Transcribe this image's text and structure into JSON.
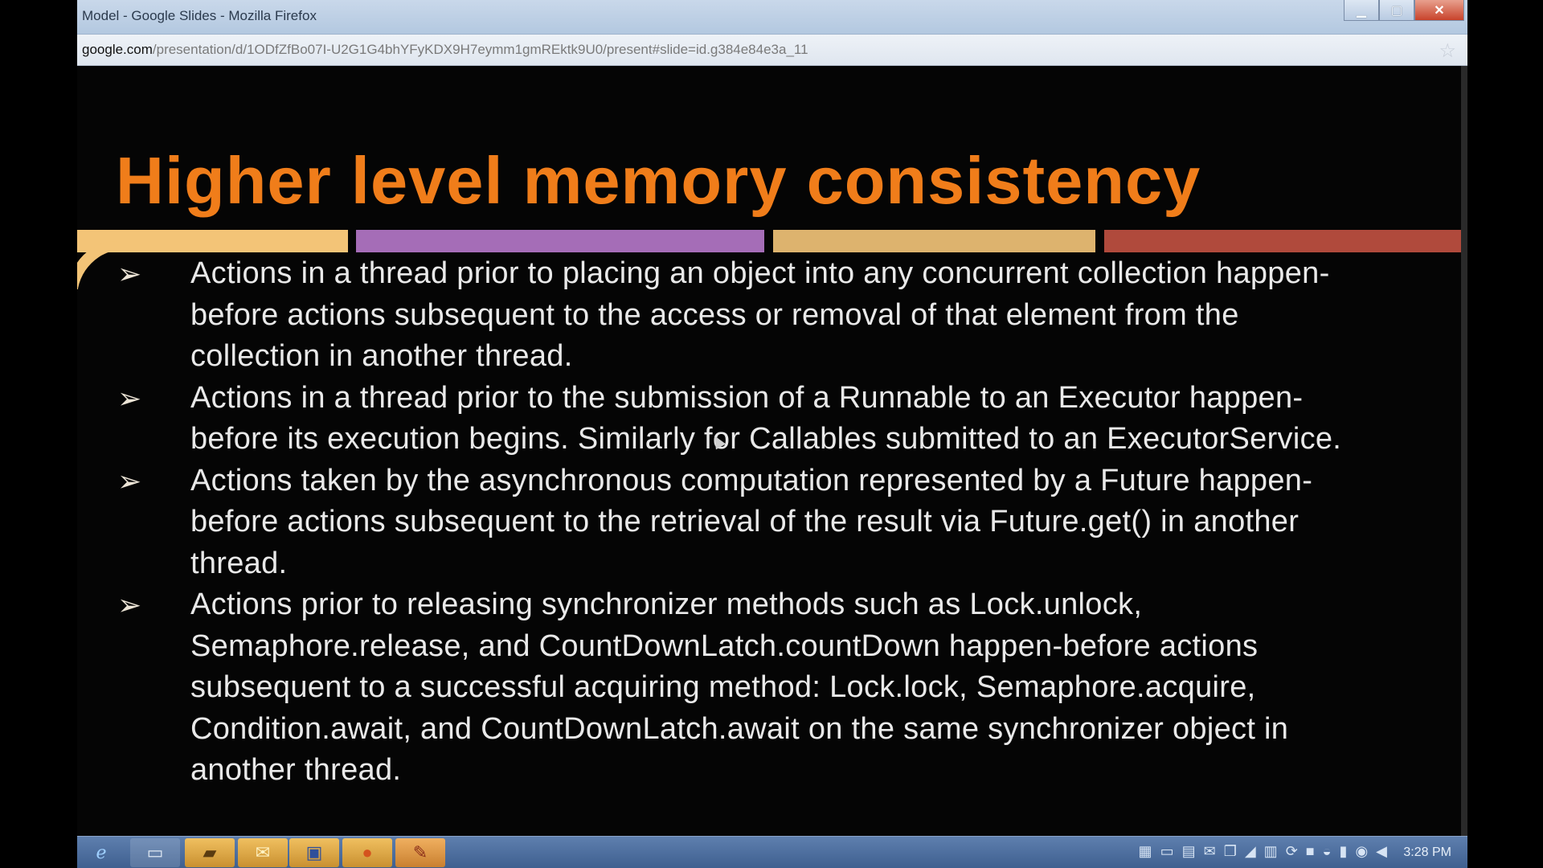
{
  "window": {
    "title": "Model - Google Slides - Mozilla Firefox",
    "minimize_icon": "minimize-icon",
    "maximize_icon": "maximize-icon",
    "close_icon": "close-icon"
  },
  "urlbar": {
    "host": "google.com",
    "path": "/presentation/d/1ODfZfBo07I-U2G1G4bhYFyKDX9H7eymm1gmREktk9U0/present#slide=id.g384e84e3a_11",
    "bookmark_icon": "star-icon"
  },
  "slide": {
    "title": "Higher level memory consistency",
    "bar_colors": [
      "#f3c477",
      "#a56db7",
      "#ddb36e",
      "#b04a3c"
    ],
    "title_color": "#f07d1a",
    "bullet_glyph": "➢",
    "bullets": [
      "Actions in a thread prior to placing an object into any concurrent collection happen-before actions subsequent to the access or removal of that element from the collection in another thread.",
      "Actions in a thread prior to the submission of a Runnable to an Executor happen-before its execution begins. Similarly for Callables submitted to an ExecutorService.",
      "Actions taken by the asynchronous computation represented by a Future happen-before actions subsequent to the retrieval of the result via Future.get() in another thread.",
      "Actions prior to releasing synchronizer methods such as Lock.unlock, Semaphore.release, and CountDownLatch.countDown happen-before actions subsequent to a successful acquiring method: Lock.lock, Semaphore.acquire, Condition.await, and CountDownLatch.await on the same synchronizer object in another thread."
    ]
  },
  "taskbar": {
    "start_icon": "ie-icon",
    "items": [
      "explorer-icon",
      "folder-icon",
      "outlook-icon",
      "remote-desktop-icon",
      "firefox-icon",
      "paint-icon"
    ],
    "clock": "3:28 PM"
  }
}
